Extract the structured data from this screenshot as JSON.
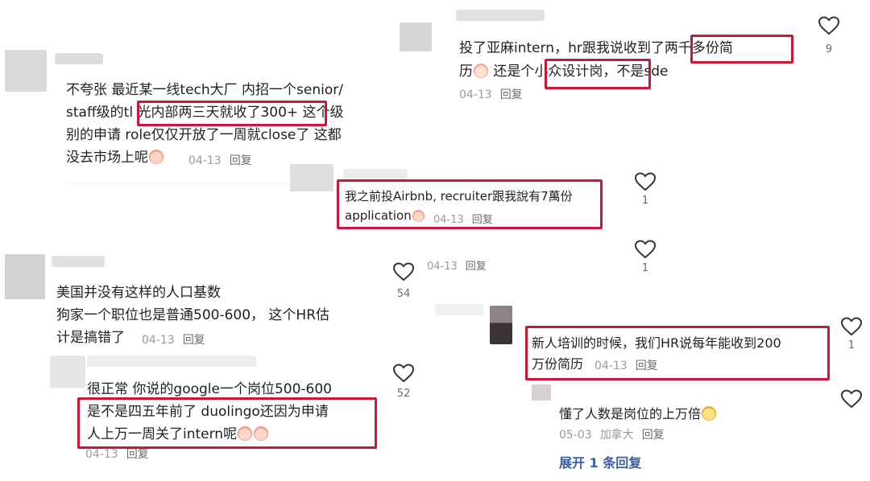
{
  "comments": {
    "c1": {
      "lines": [
        "不夸张 最近某一线tech大厂 内招一个senior/",
        "staff级的tl 光内部两三天就收了300+ 这个级",
        "别的申请 role仅仅开放了一周就close了 这都",
        "没去市场上呢"
      ],
      "date": "04-13",
      "reply": "回复"
    },
    "c2": {
      "lines": [
        "投了亚麻intern，hr跟我说收到了两千多份简",
        "历 还是个小众设计岗，不是sde"
      ],
      "date": "04-13",
      "reply": "回复",
      "likes": "9"
    },
    "c3": {
      "lines": [
        "我之前投Airbnb, recruiter跟我說有7萬份",
        "application"
      ],
      "date": "04-13",
      "reply": "回复",
      "likes": "1"
    },
    "c4": {
      "date": "04-13",
      "reply": "回复",
      "likes": "1"
    },
    "c5": {
      "lines": [
        "美国并没有这样的人口基数",
        "狗家一个职位也是普通500-600， 这个HR估",
        "计是搞错了"
      ],
      "date": "04-13",
      "reply": "回复",
      "likes": "54"
    },
    "c6": {
      "lines": [
        "很正常 你说的google一个岗位500-600",
        "是不是四五年前了 duolingo还因为申请",
        "人上万一周关了intern呢"
      ],
      "date": "04-13",
      "reply": "回复",
      "likes": "52"
    },
    "c7": {
      "lines": [
        "新人培训的时候，我们HR说每年能收到200",
        "万份简历"
      ],
      "date": "04-13",
      "reply": "回复",
      "likes": "1"
    },
    "c8": {
      "lines": [
        "懂了人数是岗位的上万倍"
      ],
      "date": "05-03",
      "location": "加拿大",
      "reply": "回复"
    },
    "expand_label": "展开 1 条回复"
  },
  "colors": {
    "highlight": "#c8183a",
    "meta": "#9a9a9a",
    "link": "#3a5da8"
  },
  "icons": {
    "like": "heart-icon",
    "emoji_cry": "crying-emoji-icon",
    "emoji_think": "thinking-emoji-icon"
  }
}
